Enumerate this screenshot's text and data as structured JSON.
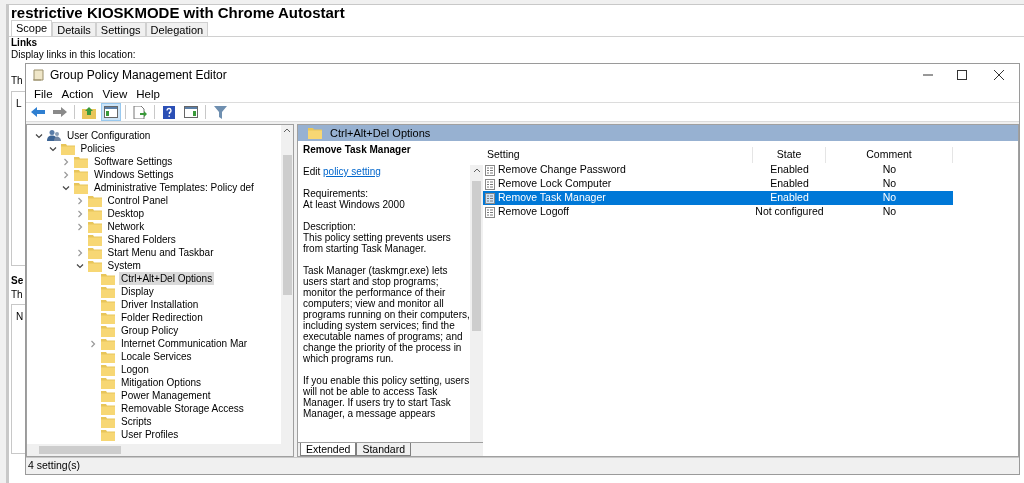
{
  "background_window": {
    "title": "restrictive KIOSKMODE with Chrome Autostart",
    "tabs": [
      {
        "label": "Scope",
        "selected": true
      },
      {
        "label": "Details",
        "selected": false
      },
      {
        "label": "Settings",
        "selected": false
      },
      {
        "label": "Delegation",
        "selected": false
      }
    ],
    "section_title": "Links",
    "field_label": "Display links in this location:",
    "fragments_top": [
      "Th",
      "L"
    ],
    "fragments_bottom": [
      "Se",
      "Th",
      "N"
    ]
  },
  "window": {
    "title": "Group Policy Management Editor",
    "menu": [
      "File",
      "Action",
      "View",
      "Help"
    ],
    "toolbar": [
      {
        "kind": "back",
        "pressed": false
      },
      {
        "kind": "forward",
        "pressed": false
      },
      {
        "kind": "sep"
      },
      {
        "kind": "up",
        "pressed": false
      },
      {
        "kind": "tree",
        "pressed": true
      },
      {
        "kind": "sep"
      },
      {
        "kind": "export",
        "pressed": false
      },
      {
        "kind": "sep"
      },
      {
        "kind": "help",
        "pressed": false
      },
      {
        "kind": "pane",
        "pressed": false
      },
      {
        "kind": "sep"
      },
      {
        "kind": "filter",
        "pressed": false
      }
    ]
  },
  "tree": [
    {
      "label": "User Configuration",
      "kind": "user",
      "expanded": true,
      "selected": false,
      "children": [
        {
          "label": "Policies",
          "kind": "folder",
          "expanded": true,
          "selected": false,
          "children": [
            {
              "label": "Software Settings",
              "kind": "folder",
              "expanded": false,
              "selected": false
            },
            {
              "label": "Windows Settings",
              "kind": "folder",
              "expanded": false,
              "selected": false
            },
            {
              "label": "Administrative Templates: Policy def",
              "kind": "folder",
              "expanded": true,
              "selected": false,
              "children": [
                {
                  "label": "Control Panel",
                  "kind": "folder",
                  "expanded": false,
                  "selected": false
                },
                {
                  "label": "Desktop",
                  "kind": "folder",
                  "expanded": false,
                  "selected": false
                },
                {
                  "label": "Network",
                  "kind": "folder",
                  "expanded": false,
                  "selected": false
                },
                {
                  "label": "Shared Folders",
                  "kind": "folder",
                  "selected": false
                },
                {
                  "label": "Start Menu and Taskbar",
                  "kind": "folder",
                  "expanded": false,
                  "selected": false
                },
                {
                  "label": "System",
                  "kind": "folder",
                  "expanded": true,
                  "selected": false,
                  "children": [
                    {
                      "label": "Ctrl+Alt+Del Options",
                      "kind": "folder",
                      "selected": true
                    },
                    {
                      "label": "Display",
                      "kind": "folder",
                      "selected": false
                    },
                    {
                      "label": "Driver Installation",
                      "kind": "folder",
                      "selected": false
                    },
                    {
                      "label": "Folder Redirection",
                      "kind": "folder",
                      "selected": false
                    },
                    {
                      "label": "Group Policy",
                      "kind": "folder",
                      "selected": false
                    },
                    {
                      "label": "Internet Communication Mar",
                      "kind": "folder",
                      "expanded": false,
                      "selected": false
                    },
                    {
                      "label": "Locale Services",
                      "kind": "folder",
                      "selected": false
                    },
                    {
                      "label": "Logon",
                      "kind": "folder",
                      "selected": false
                    },
                    {
                      "label": "Mitigation Options",
                      "kind": "folder",
                      "selected": false
                    },
                    {
                      "label": "Power Management",
                      "kind": "folder",
                      "selected": false
                    },
                    {
                      "label": "Removable Storage Access",
                      "kind": "folder",
                      "selected": false
                    },
                    {
                      "label": "Scripts",
                      "kind": "folder",
                      "selected": false
                    },
                    {
                      "label": "User Profiles",
                      "kind": "folder",
                      "selected": false
                    }
                  ]
                }
              ]
            }
          ]
        }
      ]
    }
  ],
  "details": {
    "header": "Ctrl+Alt+Del Options",
    "title": "Remove Task Manager",
    "edit_prefix": "Edit",
    "edit_link": "policy setting",
    "requirements_label": "Requirements:",
    "requirements": "At least Windows 2000",
    "description_label": "Description:",
    "paragraphs": [
      "This policy setting prevents users from starting Task Manager.",
      "Task Manager (taskmgr.exe) lets users start and stop programs; monitor the performance of their computers; view and monitor all programs running on their computers, including system services; find the executable names of programs; and change the priority of the process in which programs run.",
      "If you enable this policy setting, users will not be able to access Task Manager. If users try to start Task Manager, a message appears"
    ],
    "view_tabs": [
      {
        "label": "Extended",
        "selected": true
      },
      {
        "label": "Standard",
        "selected": false
      }
    ]
  },
  "table": {
    "columns": [
      "Setting",
      "State",
      "Comment"
    ],
    "rows": [
      {
        "setting": "Remove Change Password",
        "state": "Enabled",
        "comment": "No",
        "selected": false
      },
      {
        "setting": "Remove Lock Computer",
        "state": "Enabled",
        "comment": "No",
        "selected": false
      },
      {
        "setting": "Remove Task Manager",
        "state": "Enabled",
        "comment": "No",
        "selected": true
      },
      {
        "setting": "Remove Logoff",
        "state": "Not configured",
        "comment": "No",
        "selected": false
      }
    ]
  },
  "status_bar": "4 setting(s)"
}
